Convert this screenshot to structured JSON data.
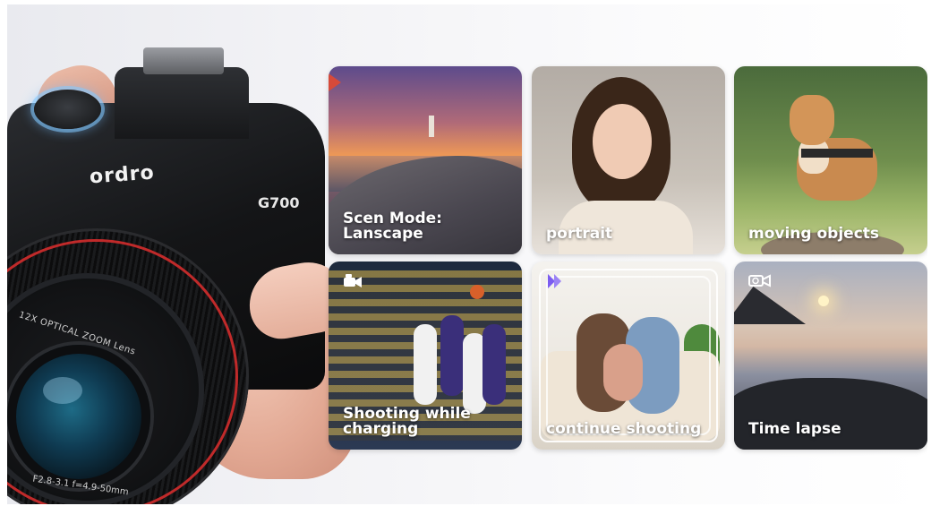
{
  "camera": {
    "brand": "ordro",
    "model": "G700",
    "lens_text_top": "12X OPTICAL ZOOM Lens",
    "lens_text_bottom": "F2.8-3.1 f=4.9-50mm"
  },
  "tiles": [
    {
      "label": "Scen Mode: Lanscape",
      "icon": ""
    },
    {
      "label": "portrait",
      "icon": ""
    },
    {
      "label": "moving objects",
      "icon": ""
    },
    {
      "label": "Shooting while charging",
      "icon": "video-camera-icon"
    },
    {
      "label": "continue shooting",
      "icon": "burst-icon"
    },
    {
      "label": "Time lapse",
      "icon": "timelapse-camera-icon"
    }
  ],
  "colors": {
    "dial_glow": "#82c8ff",
    "lens_ring": "#c02a2a"
  }
}
